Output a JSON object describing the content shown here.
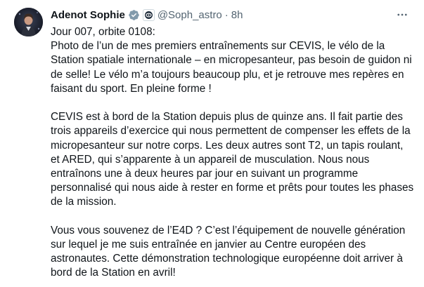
{
  "author": {
    "name": "Adenot Sophie",
    "handle": "@Soph_astro",
    "separator": "·",
    "time": "8h"
  },
  "icons": {
    "verified": "verified-badge-icon",
    "affiliation": "esa-affiliation-icon",
    "more": "more-options-icon",
    "verified_color": "#829aab"
  },
  "tweet": {
    "paragraphs": [
      "Jour 007, orbite 0108:\nPhoto de l’un de mes premiers entraînements sur CEVIS, le vélo de la Station spatiale internationale – en micropesanteur, pas besoin de guidon ni de selle! Le vélo m’a toujours beaucoup plu, et je retrouve mes repères en faisant du sport. En pleine forme !",
      "CEVIS est à bord de la Station depuis plus de quinze ans. Il fait partie des trois appareils d’exercice qui nous permettent de compenser les effets de la micropesanteur sur notre corps. Les deux autres sont T2, un tapis roulant, et ARED, qui s’apparente à un appareil de musculation. Nous nous entraînons une à deux heures par jour en suivant un programme personnalisé qui nous aide à rester en forme et prêts pour toutes les phases de la mission.",
      "Vous vous souvenez de l’E4D ? C’est l’équipement de nouvelle génération sur lequel je me suis entraînée en janvier au Centre européen des astronautes. Cette démonstration technologique européenne doit arriver à bord de la Station en avril!"
    ]
  }
}
